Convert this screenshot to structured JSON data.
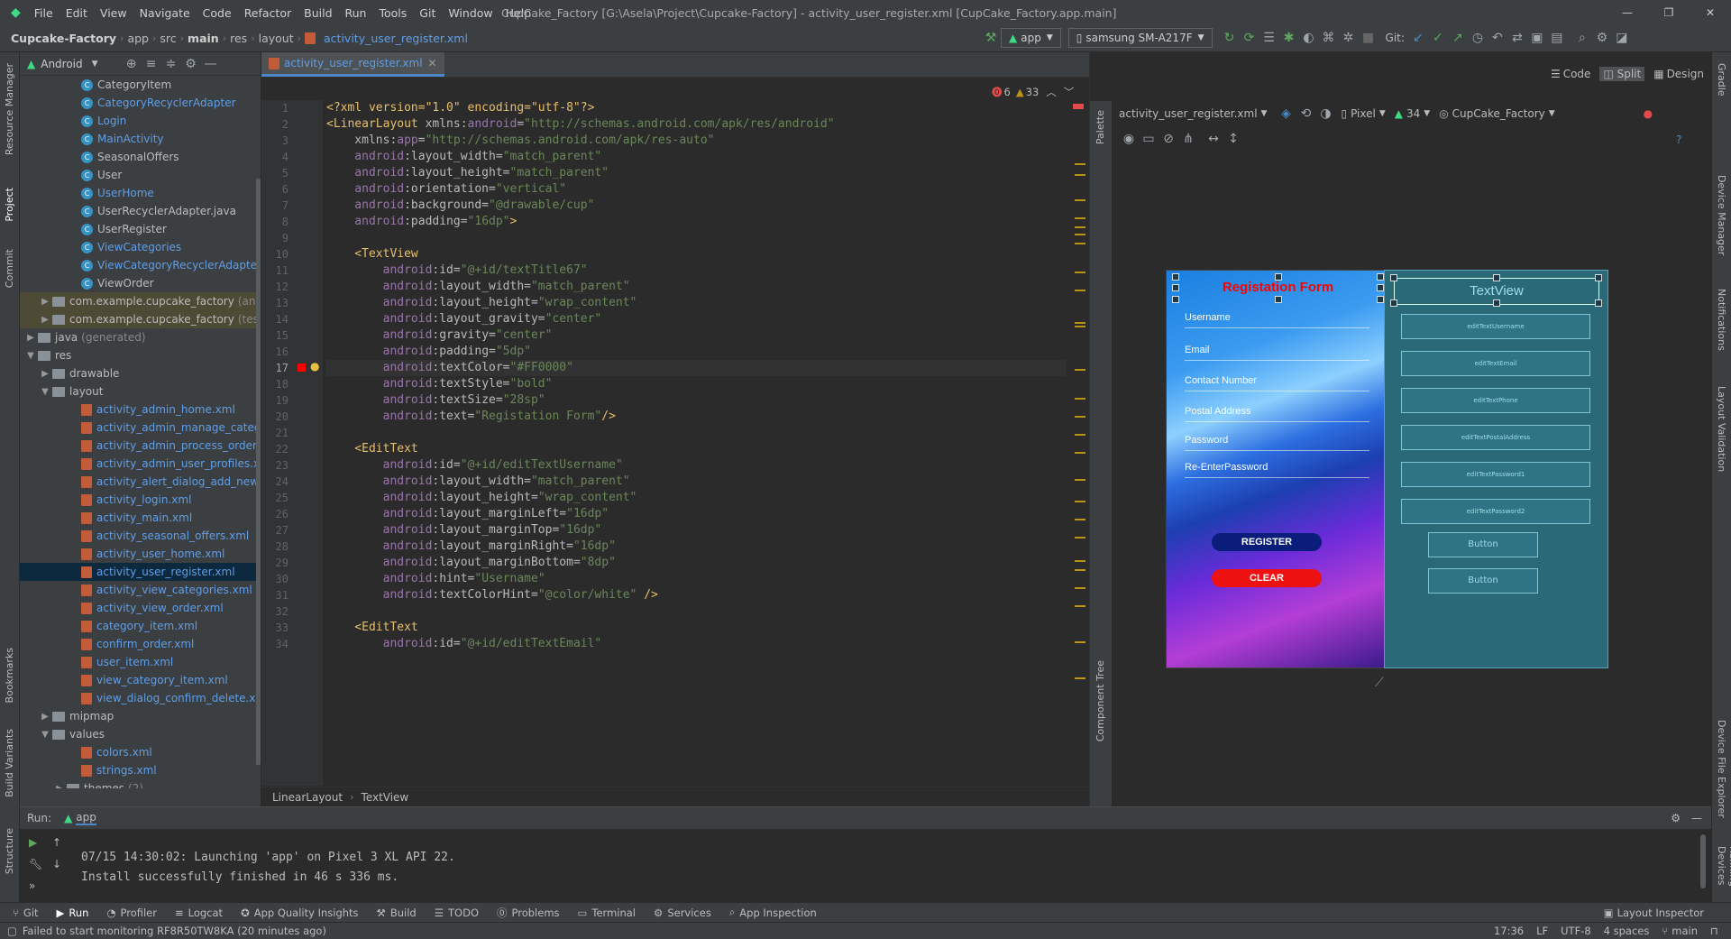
{
  "titlebar": {
    "menu": [
      "File",
      "Edit",
      "View",
      "Navigate",
      "Code",
      "Refactor",
      "Build",
      "Run",
      "Tools",
      "Git",
      "Window",
      "Help"
    ],
    "title": "CupCake_Factory [G:\\Asela\\Project\\Cupcake-Factory] - activity_user_register.xml [CupCake_Factory.app.main]"
  },
  "navbar": {
    "crumbs": [
      "Cupcake-Factory",
      "app",
      "src",
      "main",
      "res",
      "layout",
      "activity_user_register.xml"
    ],
    "run_config": "app",
    "device": "samsung SM-A217F",
    "git_label": "Git:"
  },
  "project": {
    "view_mode": "Android",
    "items": [
      {
        "label": "CategoryItem",
        "type": "class",
        "indent": 64
      },
      {
        "label": "CategoryRecyclerAdapter",
        "type": "class",
        "indent": 64,
        "blue": true
      },
      {
        "label": "Login",
        "type": "class",
        "indent": 64,
        "blue": true
      },
      {
        "label": "MainActivity",
        "type": "class",
        "indent": 64,
        "blue": true
      },
      {
        "label": "SeasonalOffers",
        "type": "class",
        "indent": 64
      },
      {
        "label": "User",
        "type": "class",
        "indent": 64
      },
      {
        "label": "UserHome",
        "type": "class",
        "indent": 64,
        "blue": true
      },
      {
        "label": "UserRecyclerAdapter.java",
        "type": "class",
        "indent": 64
      },
      {
        "label": "UserRegister",
        "type": "class",
        "indent": 64
      },
      {
        "label": "ViewCategories",
        "type": "class",
        "indent": 64,
        "blue": true
      },
      {
        "label": "ViewCategoryRecyclerAdapter",
        "type": "class",
        "indent": 64,
        "blue": true
      },
      {
        "label": "ViewOrder",
        "type": "class",
        "indent": 64
      },
      {
        "label": "com.example.cupcake_factory",
        "suffix": "(and",
        "type": "folder",
        "indent": 32,
        "arrow": "▶",
        "hl": true
      },
      {
        "label": "com.example.cupcake_factory",
        "suffix": "(test",
        "type": "folder",
        "indent": 32,
        "arrow": "▶",
        "hl": true
      },
      {
        "label": "java",
        "suffix": "(generated)",
        "type": "folder",
        "indent": 16,
        "arrow": "▶"
      },
      {
        "label": "res",
        "type": "folder",
        "indent": 16,
        "arrow": "▼"
      },
      {
        "label": "drawable",
        "type": "folder",
        "indent": 32,
        "arrow": "▶"
      },
      {
        "label": "layout",
        "type": "folder",
        "indent": 32,
        "arrow": "▼"
      },
      {
        "label": "activity_admin_home.xml",
        "type": "file",
        "indent": 64,
        "blue": true
      },
      {
        "label": "activity_admin_manage_categor",
        "type": "file",
        "indent": 64,
        "blue": true
      },
      {
        "label": "activity_admin_process_orders.x",
        "type": "file",
        "indent": 64,
        "blue": true
      },
      {
        "label": "activity_admin_user_profiles.xml",
        "type": "file",
        "indent": 64,
        "blue": true
      },
      {
        "label": "activity_alert_dialog_add_new_ca",
        "type": "file",
        "indent": 64,
        "blue": true
      },
      {
        "label": "activity_login.xml",
        "type": "file",
        "indent": 64,
        "blue": true
      },
      {
        "label": "activity_main.xml",
        "type": "file",
        "indent": 64,
        "blue": true
      },
      {
        "label": "activity_seasonal_offers.xml",
        "type": "file",
        "indent": 64,
        "blue": true
      },
      {
        "label": "activity_user_home.xml",
        "type": "file",
        "indent": 64,
        "blue": true
      },
      {
        "label": "activity_user_register.xml",
        "type": "file",
        "indent": 64,
        "blue": true,
        "selected": true
      },
      {
        "label": "activity_view_categories.xml",
        "type": "file",
        "indent": 64,
        "blue": true
      },
      {
        "label": "activity_view_order.xml",
        "type": "file",
        "indent": 64,
        "blue": true
      },
      {
        "label": "category_item.xml",
        "type": "file",
        "indent": 64,
        "blue": true
      },
      {
        "label": "confirm_order.xml",
        "type": "file",
        "indent": 64,
        "blue": true
      },
      {
        "label": "user_item.xml",
        "type": "file",
        "indent": 64,
        "blue": true
      },
      {
        "label": "view_category_item.xml",
        "type": "file",
        "indent": 64,
        "blue": true
      },
      {
        "label": "view_dialog_confirm_delete.xml",
        "type": "file",
        "indent": 64,
        "blue": true
      },
      {
        "label": "mipmap",
        "type": "folder",
        "indent": 32,
        "arrow": "▶"
      },
      {
        "label": "values",
        "type": "folder",
        "indent": 32,
        "arrow": "▼"
      },
      {
        "label": "colors.xml",
        "type": "file",
        "indent": 64,
        "blue": true
      },
      {
        "label": "strings.xml",
        "type": "file",
        "indent": 64,
        "blue": true
      },
      {
        "label": "themes",
        "suffix": "(2)",
        "type": "folder",
        "indent": 48,
        "arrow": "▶"
      }
    ]
  },
  "editor": {
    "tab": "activity_user_register.xml",
    "errors": "6",
    "warnings": "33",
    "current_line": 17,
    "lines": [
      [
        [
          "pi",
          "<?xml version=\"1.0\" encoding=\"utf-8\"?>"
        ]
      ],
      [
        [
          "tag",
          "<LinearLayout "
        ],
        [
          "attr",
          "xmlns:"
        ],
        [
          "ns",
          "android"
        ],
        [
          "attr",
          "="
        ],
        [
          "val",
          "\"http://schemas.android.com/apk/res/android\""
        ]
      ],
      [
        [
          "attr",
          "    xmlns:"
        ],
        [
          "ns",
          "app"
        ],
        [
          "attr",
          "="
        ],
        [
          "val",
          "\"http://schemas.android.com/apk/res-auto\""
        ]
      ],
      [
        [
          "ns",
          "    android"
        ],
        [
          "attr",
          ":layout_width="
        ],
        [
          "val",
          "\"match_parent\""
        ]
      ],
      [
        [
          "ns",
          "    android"
        ],
        [
          "attr",
          ":layout_height="
        ],
        [
          "val",
          "\"match_parent\""
        ]
      ],
      [
        [
          "ns",
          "    android"
        ],
        [
          "attr",
          ":orientation="
        ],
        [
          "val",
          "\"vertical\""
        ]
      ],
      [
        [
          "ns",
          "    android"
        ],
        [
          "attr",
          ":background="
        ],
        [
          "val",
          "\"@drawable/cup\""
        ]
      ],
      [
        [
          "ns",
          "    android"
        ],
        [
          "attr",
          ":padding="
        ],
        [
          "val",
          "\"16dp\""
        ],
        [
          "tag",
          ">"
        ]
      ],
      [
        [
          "attr",
          ""
        ]
      ],
      [
        [
          "tag",
          "    <TextView"
        ]
      ],
      [
        [
          "ns",
          "        android"
        ],
        [
          "attr",
          ":id="
        ],
        [
          "val",
          "\"@+id/textTitle67\""
        ]
      ],
      [
        [
          "ns",
          "        android"
        ],
        [
          "attr",
          ":layout_width="
        ],
        [
          "val",
          "\"match_parent\""
        ]
      ],
      [
        [
          "ns",
          "        android"
        ],
        [
          "attr",
          ":layout_height="
        ],
        [
          "val",
          "\"wrap_content\""
        ]
      ],
      [
        [
          "ns",
          "        android"
        ],
        [
          "attr",
          ":layout_gravity="
        ],
        [
          "val",
          "\"center\""
        ]
      ],
      [
        [
          "ns",
          "        android"
        ],
        [
          "attr",
          ":gravity="
        ],
        [
          "val",
          "\"center\""
        ]
      ],
      [
        [
          "ns",
          "        android"
        ],
        [
          "attr",
          ":padding="
        ],
        [
          "val",
          "\"5dp\""
        ]
      ],
      [
        [
          "ns",
          "        android"
        ],
        [
          "attr",
          ":textColor="
        ],
        [
          "val",
          "\"#FF0000\""
        ]
      ],
      [
        [
          "ns",
          "        android"
        ],
        [
          "attr",
          ":textStyle="
        ],
        [
          "val",
          "\"bold\""
        ]
      ],
      [
        [
          "ns",
          "        android"
        ],
        [
          "attr",
          ":textSize="
        ],
        [
          "val",
          "\"28sp\""
        ]
      ],
      [
        [
          "ns",
          "        android"
        ],
        [
          "attr",
          ":text="
        ],
        [
          "val",
          "\"Registation Form\""
        ],
        [
          "tag",
          "/>"
        ]
      ],
      [
        [
          "attr",
          ""
        ]
      ],
      [
        [
          "tag",
          "    <EditText"
        ]
      ],
      [
        [
          "ns",
          "        android"
        ],
        [
          "attr",
          ":id="
        ],
        [
          "val",
          "\"@+id/editTextUsername\""
        ]
      ],
      [
        [
          "ns",
          "        android"
        ],
        [
          "attr",
          ":layout_width="
        ],
        [
          "val",
          "\"match_parent\""
        ]
      ],
      [
        [
          "ns",
          "        android"
        ],
        [
          "attr",
          ":layout_height="
        ],
        [
          "val",
          "\"wrap_content\""
        ]
      ],
      [
        [
          "ns",
          "        android"
        ],
        [
          "attr",
          ":layout_marginLeft="
        ],
        [
          "val",
          "\"16dp\""
        ]
      ],
      [
        [
          "ns",
          "        android"
        ],
        [
          "attr",
          ":layout_marginTop="
        ],
        [
          "val",
          "\"16dp\""
        ]
      ],
      [
        [
          "ns",
          "        android"
        ],
        [
          "attr",
          ":layout_marginRight="
        ],
        [
          "val",
          "\"16dp\""
        ]
      ],
      [
        [
          "ns",
          "        android"
        ],
        [
          "attr",
          ":layout_marginBottom="
        ],
        [
          "val",
          "\"8dp\""
        ]
      ],
      [
        [
          "ns",
          "        android"
        ],
        [
          "attr",
          ":hint="
        ],
        [
          "val",
          "\"Username\""
        ]
      ],
      [
        [
          "ns",
          "        android"
        ],
        [
          "attr",
          ":textColorHint="
        ],
        [
          "val",
          "\"@color/white\""
        ],
        [
          "tag",
          " />"
        ]
      ],
      [
        [
          "attr",
          ""
        ]
      ],
      [
        [
          "tag",
          "    <EditText"
        ]
      ],
      [
        [
          "ns",
          "        android"
        ],
        [
          "attr",
          ":id="
        ],
        [
          "val",
          "\"@+id/editTextEmail\""
        ]
      ]
    ],
    "breadcrumb": [
      "LinearLayout",
      "TextView"
    ]
  },
  "design": {
    "file_combo": "activity_user_register.xml",
    "device": "Pixel",
    "api": "34",
    "theme": "CupCake_Factory",
    "modes": [
      "Code",
      "Split",
      "Design"
    ],
    "palette_label": "Palette",
    "component_tree_label": "Component Tree",
    "preview": {
      "title": "Registation Form",
      "fields": [
        "Username",
        "Email",
        "Contact Number",
        "Postal Address",
        "Password",
        "Re-EnterPassword"
      ],
      "register": "REGISTER",
      "clear": "CLEAR"
    },
    "blueprint": {
      "title": "TextView",
      "fields": [
        "editTextUsername",
        "editTextEmail",
        "editTextPhone",
        "editTextPostalAddress",
        "editTextPassword1",
        "editTextPassword2"
      ],
      "buttons": [
        "Button",
        "Button"
      ]
    }
  },
  "run": {
    "label": "Run:",
    "config": "app",
    "lines": [
      "07/15 14:30:02: Launching 'app' on Pixel 3 XL API 22.",
      "Install successfully finished in 46 s 336 ms."
    ]
  },
  "bottom_tabs": [
    "Git",
    "Run",
    "Profiler",
    "Logcat",
    "App Quality Insights",
    "Build",
    "TODO",
    "Problems",
    "Terminal",
    "Services",
    "App Inspection"
  ],
  "layout_inspector": "Layout Inspector",
  "status": {
    "message": "Failed to start monitoring RF8R50TW8KA (20 minutes ago)",
    "position": "17:36",
    "line_sep": "LF",
    "encoding": "UTF-8",
    "indent": "4 spaces",
    "branch": "main"
  },
  "left_strip": [
    "Resource Manager",
    "Project",
    "Commit",
    "Bookmarks",
    "Build Variants",
    "Structure"
  ],
  "right_strip": [
    "Gradle",
    "Device Manager",
    "Notifications",
    "Layout Validation",
    "Device File Explorer",
    "Running Devices"
  ],
  "colors": {
    "accent": "#4a88c7",
    "error": "#e44a4a",
    "warning": "#be9117",
    "title_red": "#ff0000"
  }
}
